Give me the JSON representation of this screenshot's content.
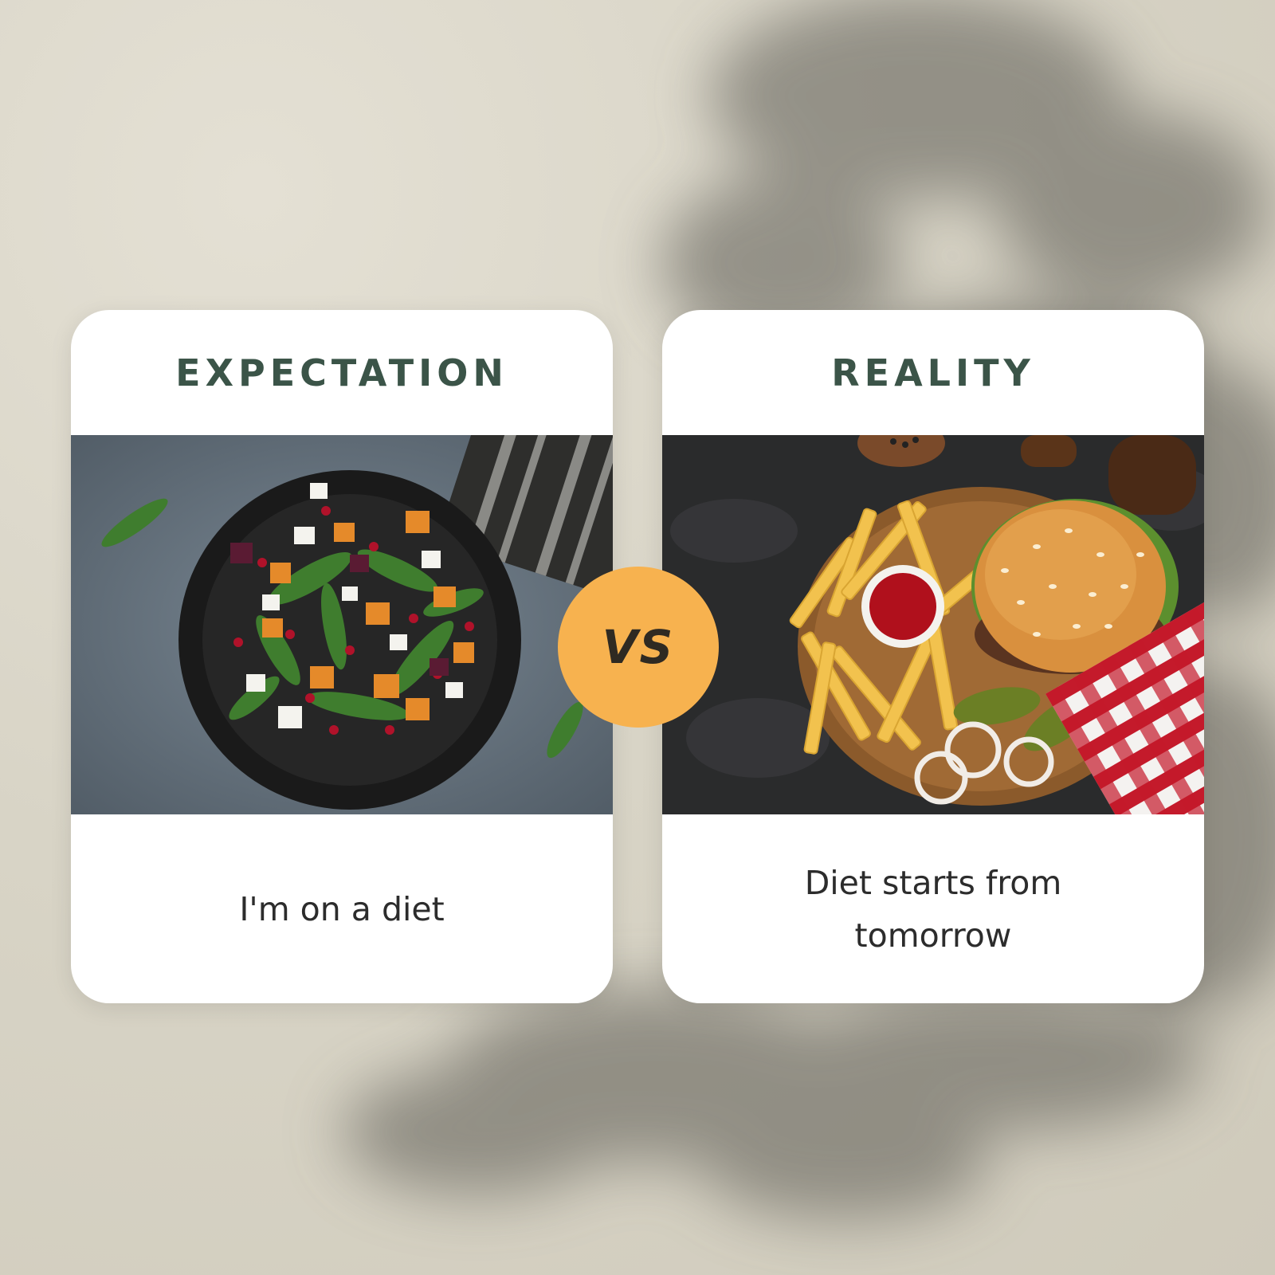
{
  "expectation": {
    "title": "EXPECTATION",
    "caption": "I'm on a diet",
    "photo_icon": "salad-bowl-photo"
  },
  "reality": {
    "title": "REALITY",
    "caption_line1": "Diet starts from",
    "caption_line2": "tomorrow",
    "photo_icon": "burger-and-fries-photo"
  },
  "vs_label": "VS",
  "colors": {
    "title": "#3b5448",
    "badge": "#f7b24f",
    "caption": "#2c2c2c",
    "background": "#d8d4c6"
  }
}
